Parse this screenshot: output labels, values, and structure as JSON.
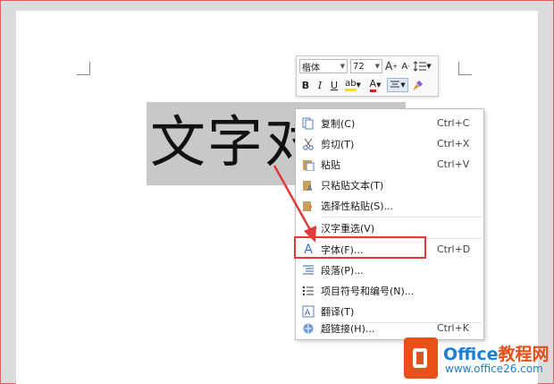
{
  "document": {
    "selected_text": "文字对"
  },
  "mini_toolbar": {
    "font_name": "楷体",
    "font_size": "72",
    "grow_font": "A",
    "shrink_font": "A",
    "bold": "B",
    "italic": "I",
    "underline": "U",
    "highlight": "ab",
    "font_color": "A"
  },
  "context_menu": {
    "items": [
      {
        "label": "复制(C)",
        "shortcut": "Ctrl+C",
        "icon": "copy-icon"
      },
      {
        "label": "剪切(T)",
        "shortcut": "Ctrl+X",
        "icon": "scissors-icon"
      },
      {
        "label": "粘贴",
        "shortcut": "Ctrl+V",
        "icon": "paste-icon"
      },
      {
        "label": "只粘贴文本(T)",
        "shortcut": "",
        "icon": "paste-text-icon"
      },
      {
        "label": "选择性粘贴(S)...",
        "shortcut": "",
        "icon": "paste-special-icon"
      },
      {
        "label": "汉字重选(V)",
        "shortcut": "",
        "icon": ""
      },
      {
        "label": "字体(F)...",
        "shortcut": "Ctrl+D",
        "icon": "font-icon"
      },
      {
        "label": "段落(P)...",
        "shortcut": "",
        "icon": "paragraph-icon"
      },
      {
        "label": "项目符号和编号(N)...",
        "shortcut": "",
        "icon": "bullets-icon"
      },
      {
        "label": "翻译(T)",
        "shortcut": "",
        "icon": "translate-icon"
      },
      {
        "label": "超链接(H)...",
        "shortcut": "Ctrl+K",
        "icon": "hyperlink-icon"
      }
    ]
  },
  "annotation": {
    "color": "#e03a3a"
  },
  "watermark": {
    "brand_main": "Office",
    "brand_accent": "教程网",
    "url": "www.office26.com"
  }
}
